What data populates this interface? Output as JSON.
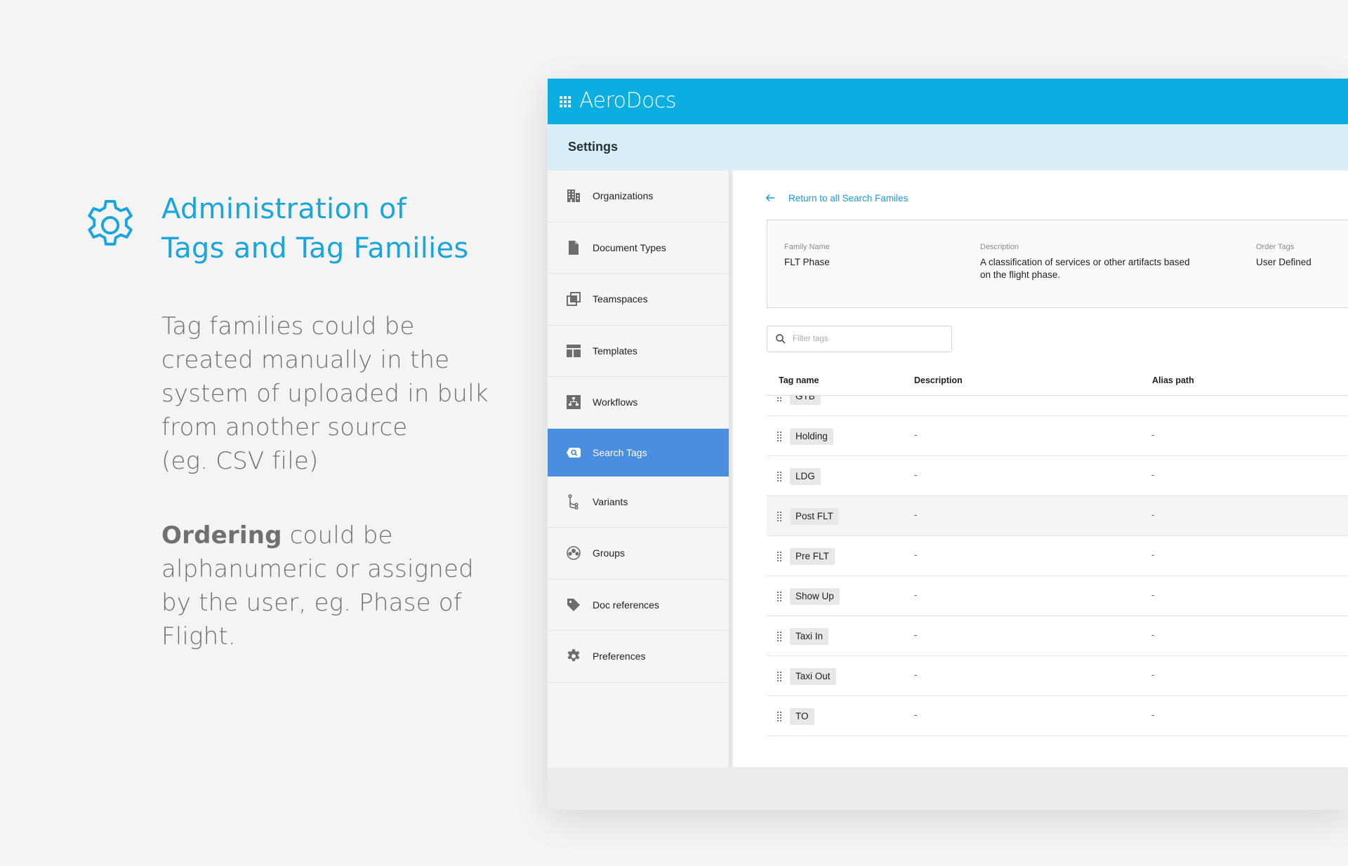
{
  "promo": {
    "title_line1": "Administration of",
    "title_line2": "Tags and Tag Families",
    "p1_lines": [
      "Tag families could be",
      "created manually in the",
      "system of uploaded in bulk",
      "from another source",
      "(eg. CSV file)"
    ],
    "p2_bold": "Ordering",
    "p2_rest_first": " could be",
    "p2_lines": [
      "alphanumeric or assigned",
      "by the user, eg. Phase of",
      "Flight."
    ],
    "accent_color": "#1aa6dd",
    "icon": "gear-icon"
  },
  "app": {
    "brand": "AeroDocs",
    "brand_color": "#0aaee0",
    "section_title": "Settings"
  },
  "sidebar": {
    "items": [
      {
        "label": "Organizations",
        "icon": "building-icon"
      },
      {
        "label": "Document Types",
        "icon": "document-icon"
      },
      {
        "label": "Teamspaces",
        "icon": "teamspaces-icon"
      },
      {
        "label": "Templates",
        "icon": "template-icon"
      },
      {
        "label": "Workflows",
        "icon": "workflow-icon"
      },
      {
        "label": "Search Tags",
        "icon": "search-tag-icon",
        "active": true
      },
      {
        "label": "Variants",
        "icon": "variants-icon"
      },
      {
        "label": "Groups",
        "icon": "groups-icon"
      },
      {
        "label": "Doc references",
        "icon": "tag-icon"
      },
      {
        "label": "Preferences",
        "icon": "gear-icon"
      }
    ],
    "active_color": "#4a8ee0"
  },
  "main": {
    "back_link": "Return to all Search  Familes",
    "family": {
      "name_label": "Family Name",
      "name_value": "FLT Phase",
      "desc_label": "Description",
      "desc_value_line1": "A classification of services or other artifacts based",
      "desc_value_line2": "on the flight phase.",
      "order_label": "Order Tags",
      "order_value": "User Defined"
    },
    "filter_placeholder": "Filter tags",
    "columns": [
      "Tag name",
      "Description",
      "Alias path"
    ],
    "rows": [
      {
        "tag": "GTB",
        "description": "-",
        "alias": "-"
      },
      {
        "tag": "Holding",
        "description": "-",
        "alias": "-"
      },
      {
        "tag": "LDG",
        "description": "-",
        "alias": "-"
      },
      {
        "tag": "Post FLT",
        "description": "-",
        "alias": "-",
        "highlight": true
      },
      {
        "tag": "Pre FLT",
        "description": "-",
        "alias": "-"
      },
      {
        "tag": "Show Up",
        "description": "-",
        "alias": "-"
      },
      {
        "tag": "Taxi In",
        "description": "-",
        "alias": "-"
      },
      {
        "tag": "Taxi Out",
        "description": "-",
        "alias": "-"
      },
      {
        "tag": "TO",
        "description": "-",
        "alias": "-"
      }
    ]
  }
}
